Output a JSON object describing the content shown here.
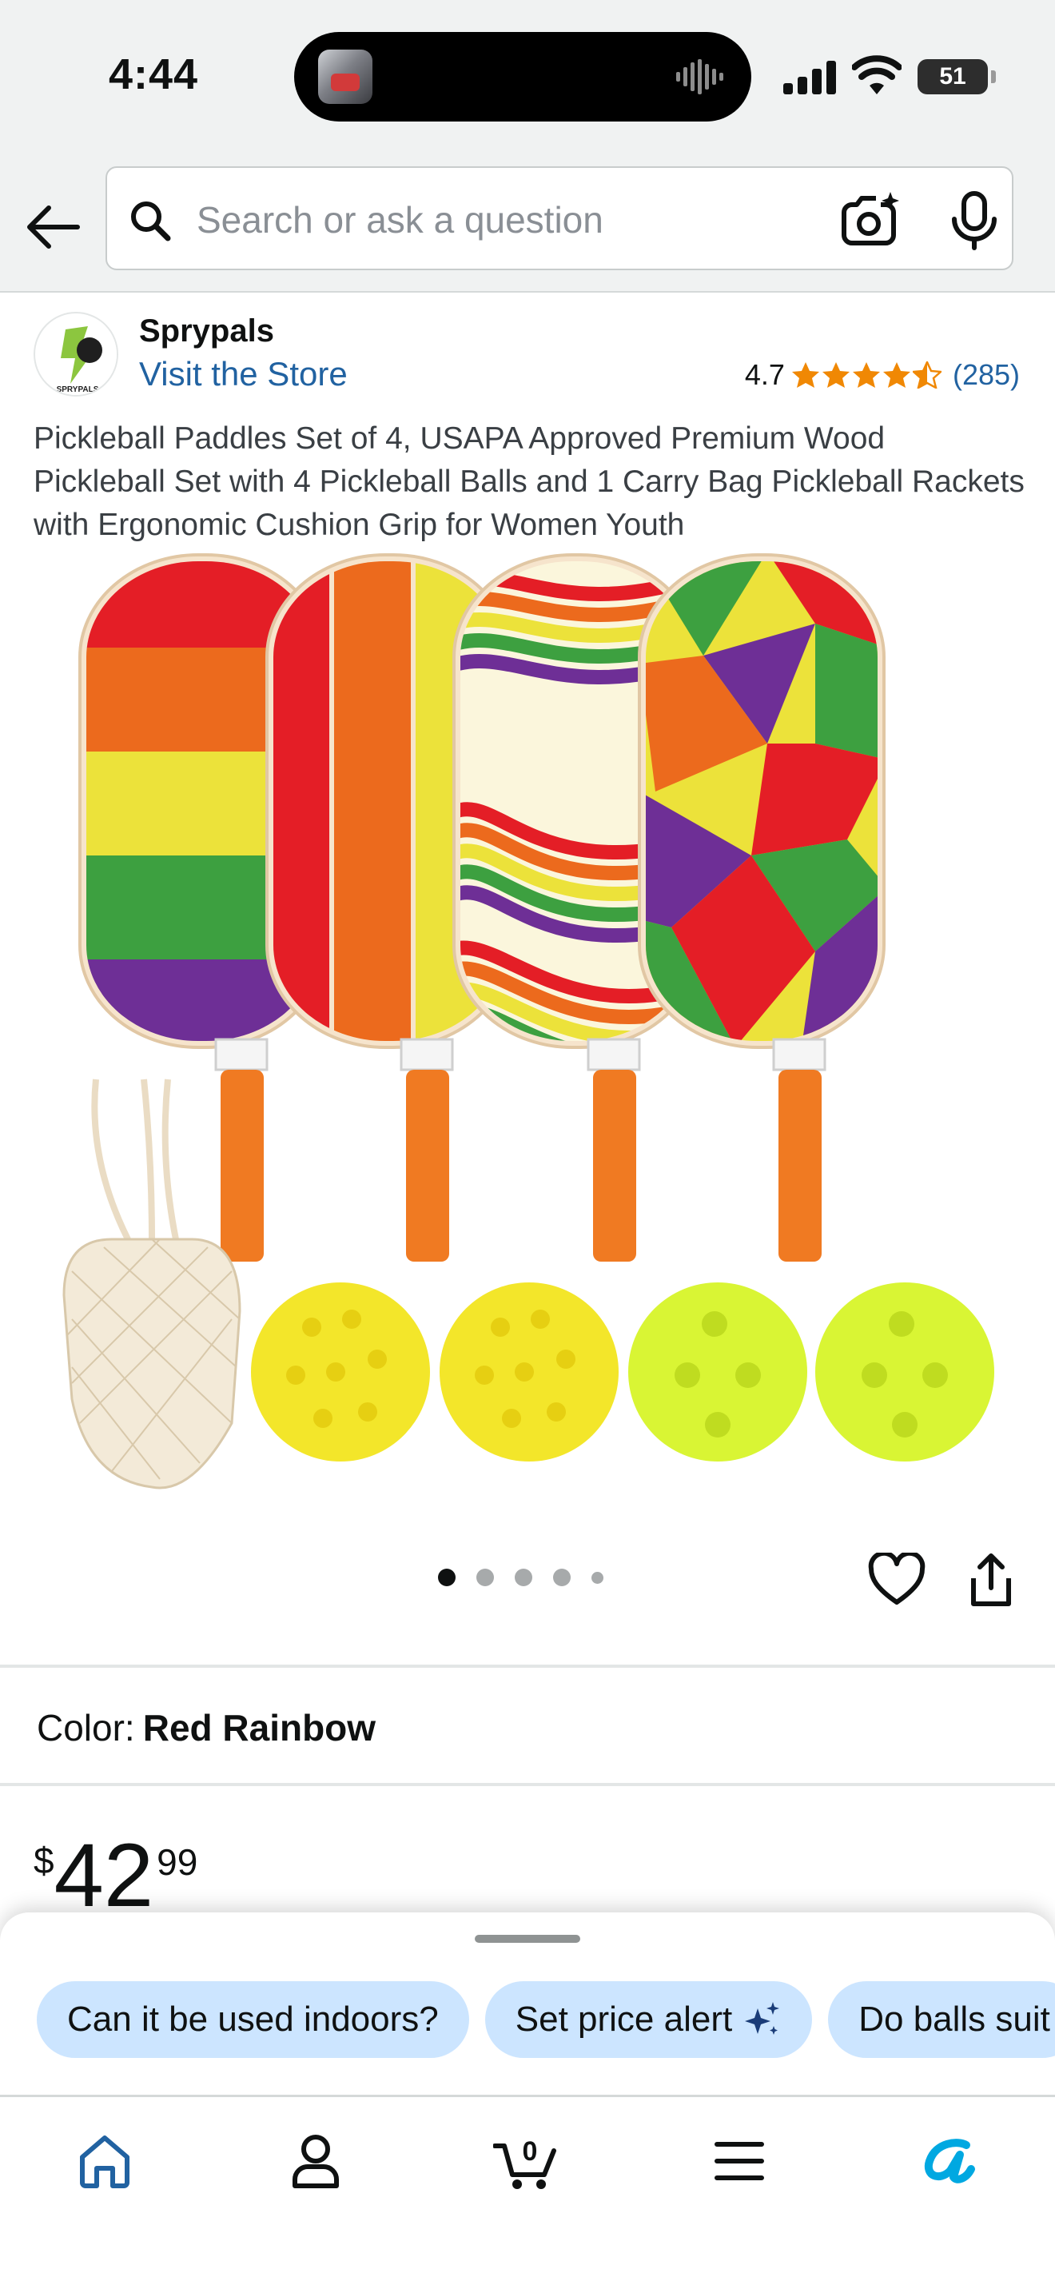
{
  "status_bar": {
    "time": "4:44",
    "battery": "51"
  },
  "search": {
    "placeholder": "Search or ask a question",
    "value": ""
  },
  "store": {
    "logo_text": "SPRYPALS",
    "name": "Sprypals",
    "visit_link": "Visit the Store"
  },
  "rating": {
    "value": "4.7",
    "stars": 4.7,
    "count": "(285)"
  },
  "product": {
    "title": "Pickleball Paddles Set of 4, USAPA Approved Premium Wood Pickleball Set with 4 Pickleball Balls and 1 Carry Bag Pickleball Rackets with Ergonomic Cushion Grip for Women Youth",
    "image_count": 5,
    "current_image": 1,
    "color_label": "Color:",
    "color_value": "Red Rainbow",
    "price_symbol": "$",
    "price_whole": "42",
    "price_fraction": "99"
  },
  "suggestions": [
    {
      "label": "Can it be used indoors?"
    },
    {
      "label": "Set price alert"
    },
    {
      "label": "Do balls suit"
    }
  ],
  "nav": {
    "cart_count": "0",
    "items": [
      "home-icon",
      "account-icon",
      "cart-icon",
      "menu-icon",
      "rufus-icon"
    ]
  },
  "colors": {
    "link": "#2162a1",
    "star": "#f08804",
    "chip_bg": "#cce5ff",
    "nav_active": "#2162a1",
    "rufus_a": "#00a8e1"
  }
}
